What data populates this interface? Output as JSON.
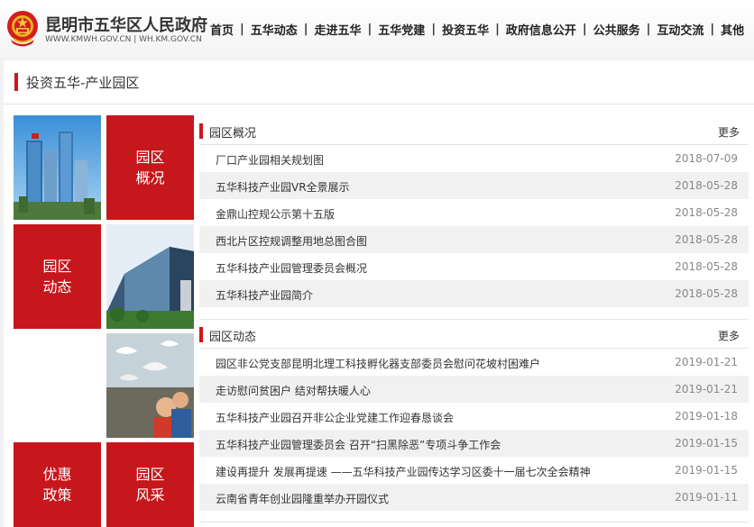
{
  "header": {
    "site_title": "昆明市五华区人民政府",
    "site_urls": "WWW.KMWH.GOV.CN | WH.KM.GOV.CN",
    "nav": [
      "首页",
      "五华动态",
      "走进五华",
      "五华党建",
      "投资五华",
      "政府信息公开",
      "公共服务",
      "互动交流",
      "其他"
    ],
    "nav_separator": "|"
  },
  "page": {
    "heading": "投资五华-产业园区"
  },
  "tiles": {
    "overview": "园区概况",
    "news": "园区动态",
    "policy": "优惠政策",
    "style": "园区风采"
  },
  "sections": [
    {
      "title": "园区概况",
      "more": "更多",
      "items": [
        {
          "title": "厂口产业园相关规划图",
          "date": "2018-07-09"
        },
        {
          "title": "五华科技产业园VR全景展示",
          "date": "2018-05-28"
        },
        {
          "title": "金鼎山控规公示第十五版",
          "date": "2018-05-28"
        },
        {
          "title": "西北片区控规调整用地总图合图",
          "date": "2018-05-28"
        },
        {
          "title": "五华科技产业园管理委员会概况",
          "date": "2018-05-28"
        },
        {
          "title": "五华科技产业园简介",
          "date": "2018-05-28"
        }
      ]
    },
    {
      "title": "园区动态",
      "more": "更多",
      "items": [
        {
          "title": "园区非公党支部昆明北理工科技孵化器支部委员会慰问花坡村困难户",
          "date": "2019-01-21"
        },
        {
          "title": "走访慰问贫困户 结对帮扶暖人心",
          "date": "2019-01-21"
        },
        {
          "title": "五华科技产业园召开非公企业党建工作迎春恳谈会",
          "date": "2019-01-18"
        },
        {
          "title": "五华科技产业园管理委员会 召开“扫黑除恶”专项斗争工作会",
          "date": "2019-01-15"
        },
        {
          "title": "建设再提升 发展再提速 ——五华科技产业园传达学习区委十一届七次全会精神",
          "date": "2019-01-15"
        },
        {
          "title": "云南省青年创业园隆重举办开园仪式",
          "date": "2019-01-11"
        }
      ]
    }
  ],
  "colors": {
    "accent_red": "#c5171c",
    "row_alt": "#f1f1f1"
  }
}
